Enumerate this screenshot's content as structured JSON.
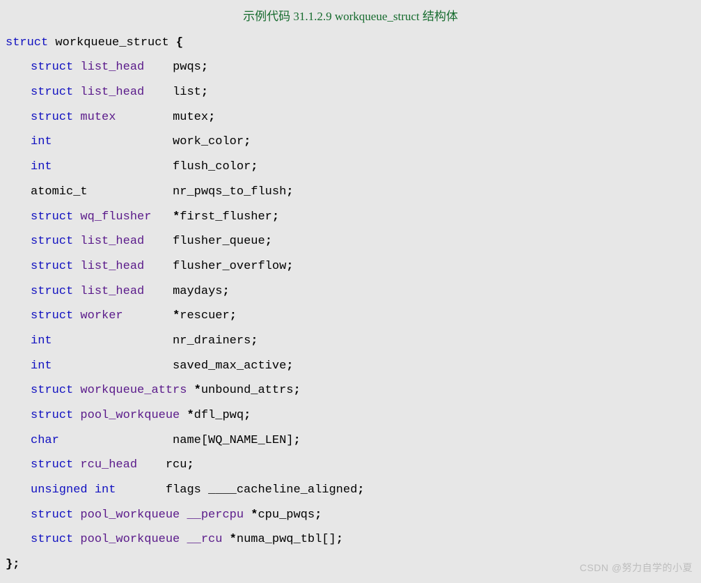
{
  "title": "示例代码 31.1.2.9 workqueue_struct 结构体",
  "decl": {
    "kw": "struct",
    "name": "workqueue_struct",
    "open": "{"
  },
  "rows": [
    {
      "kw": "struct",
      "t": "list_head",
      "pad": 20,
      "ptr": "",
      "name": "pwqs",
      "term": ";"
    },
    {
      "kw": "struct",
      "t": "list_head",
      "pad": 20,
      "ptr": "",
      "name": "list",
      "term": ";"
    },
    {
      "kw": "struct",
      "t": "mutex",
      "pad": 20,
      "ptr": "",
      "name": "mutex",
      "term": ";"
    },
    {
      "kw": "int",
      "t": "",
      "pad": 20,
      "ptr": "",
      "name": "work_color",
      "term": ";"
    },
    {
      "kw": "int",
      "t": "",
      "pad": 20,
      "ptr": "",
      "name": "flush_color",
      "term": ";"
    },
    {
      "kw": "",
      "t": "atomic_t",
      "pad": 20,
      "ptr": "",
      "name": "nr_pwqs_to_flush",
      "term": ";",
      "plain_t": true
    },
    {
      "kw": "struct",
      "t": "wq_flusher",
      "pad": 20,
      "ptr": "*",
      "name": "first_flusher",
      "term": ";"
    },
    {
      "kw": "struct",
      "t": "list_head",
      "pad": 20,
      "ptr": "",
      "name": "flusher_queue",
      "term": ";"
    },
    {
      "kw": "struct",
      "t": "list_head",
      "pad": 20,
      "ptr": "",
      "name": "flusher_overflow",
      "term": ";"
    },
    {
      "kw": "struct",
      "t": "list_head",
      "pad": 20,
      "ptr": "",
      "name": "maydays",
      "term": ";"
    },
    {
      "kw": "struct",
      "t": "worker",
      "pad": 20,
      "ptr": "*",
      "name": "rescuer",
      "term": ";"
    },
    {
      "kw": "int",
      "t": "",
      "pad": 20,
      "ptr": "",
      "name": "nr_drainers",
      "term": ";"
    },
    {
      "kw": "int",
      "t": "",
      "pad": 20,
      "ptr": "",
      "name": "saved_max_active",
      "term": ";"
    },
    {
      "kw": "struct",
      "t": "workqueue_attrs",
      "pad": 21,
      "ptr": "*",
      "name": "unbound_attrs",
      "term": ";"
    },
    {
      "kw": "struct",
      "t": "pool_workqueue",
      "pad": 21,
      "ptr": "*",
      "name": "dfl_pwq",
      "term": ";"
    },
    {
      "kw": "char",
      "t": "",
      "pad": 20,
      "ptr": "",
      "name": "name[WQ_NAME_LEN]",
      "term": ";"
    },
    {
      "kw": "struct",
      "t": "rcu_head",
      "pad": 19,
      "ptr": "",
      "name": "rcu",
      "term": ";"
    },
    {
      "kw": "unsigned int",
      "t": "",
      "pad": 19,
      "ptr": "",
      "name": "flags ____cacheline_aligned",
      "term": ";"
    },
    {
      "kw": "struct",
      "t": "pool_workqueue __percpu",
      "pad": 0,
      "ptr": "*",
      "name": "cpu_pwqs",
      "term": ";",
      "inline": true
    },
    {
      "kw": "struct",
      "t": "pool_workqueue __rcu",
      "pad": 0,
      "ptr": "*",
      "name": "numa_pwq_tbl[]",
      "term": ";",
      "inline": true
    }
  ],
  "close": "};",
  "watermark": "CSDN @努力自学的小夏"
}
